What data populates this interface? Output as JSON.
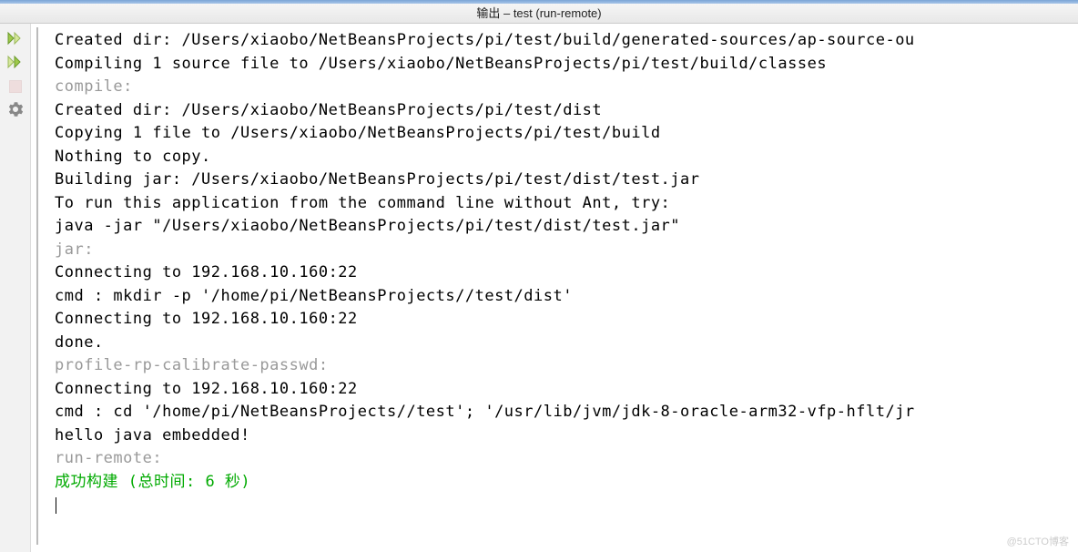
{
  "window": {
    "title": "输出 – test (run-remote)"
  },
  "toolbar": {
    "buttons": [
      {
        "name": "rerun-button",
        "icon": "play-play-icon"
      },
      {
        "name": "rerun-alt-button",
        "icon": "play-play-alt-icon"
      },
      {
        "name": "stop-button",
        "icon": "stop-icon"
      },
      {
        "name": "settings-button",
        "icon": "gear-icon"
      }
    ]
  },
  "output": {
    "lines": [
      {
        "type": "normal",
        "text": "Created dir: /Users/xiaobo/NetBeansProjects/pi/test/build/generated-sources/ap-source-ou"
      },
      {
        "type": "normal",
        "text": "Compiling 1 source file to /Users/xiaobo/NetBeansProjects/pi/test/build/classes"
      },
      {
        "type": "target",
        "text": "compile:"
      },
      {
        "type": "normal",
        "text": "Created dir: /Users/xiaobo/NetBeansProjects/pi/test/dist"
      },
      {
        "type": "normal",
        "text": "Copying 1 file to /Users/xiaobo/NetBeansProjects/pi/test/build"
      },
      {
        "type": "normal",
        "text": "Nothing to copy."
      },
      {
        "type": "normal",
        "text": "Building jar: /Users/xiaobo/NetBeansProjects/pi/test/dist/test.jar"
      },
      {
        "type": "normal",
        "text": "To run this application from the command line without Ant, try:"
      },
      {
        "type": "normal",
        "text": "java -jar \"/Users/xiaobo/NetBeansProjects/pi/test/dist/test.jar\""
      },
      {
        "type": "target",
        "text": "jar:"
      },
      {
        "type": "normal",
        "text": "Connecting to 192.168.10.160:22"
      },
      {
        "type": "normal",
        "text": "cmd : mkdir -p '/home/pi/NetBeansProjects//test/dist'"
      },
      {
        "type": "normal",
        "text": "Connecting to 192.168.10.160:22"
      },
      {
        "type": "normal",
        "text": "done."
      },
      {
        "type": "target",
        "text": "profile-rp-calibrate-passwd:"
      },
      {
        "type": "normal",
        "text": "Connecting to 192.168.10.160:22"
      },
      {
        "type": "normal",
        "text": "cmd : cd '/home/pi/NetBeansProjects//test'; '/usr/lib/jvm/jdk-8-oracle-arm32-vfp-hflt/jr"
      },
      {
        "type": "normal",
        "text": "hello java embedded!"
      },
      {
        "type": "target",
        "text": "run-remote:"
      },
      {
        "type": "success",
        "text": "成功构建 (总时间: 6 秒)"
      }
    ]
  },
  "watermark": "@51CTO博客"
}
